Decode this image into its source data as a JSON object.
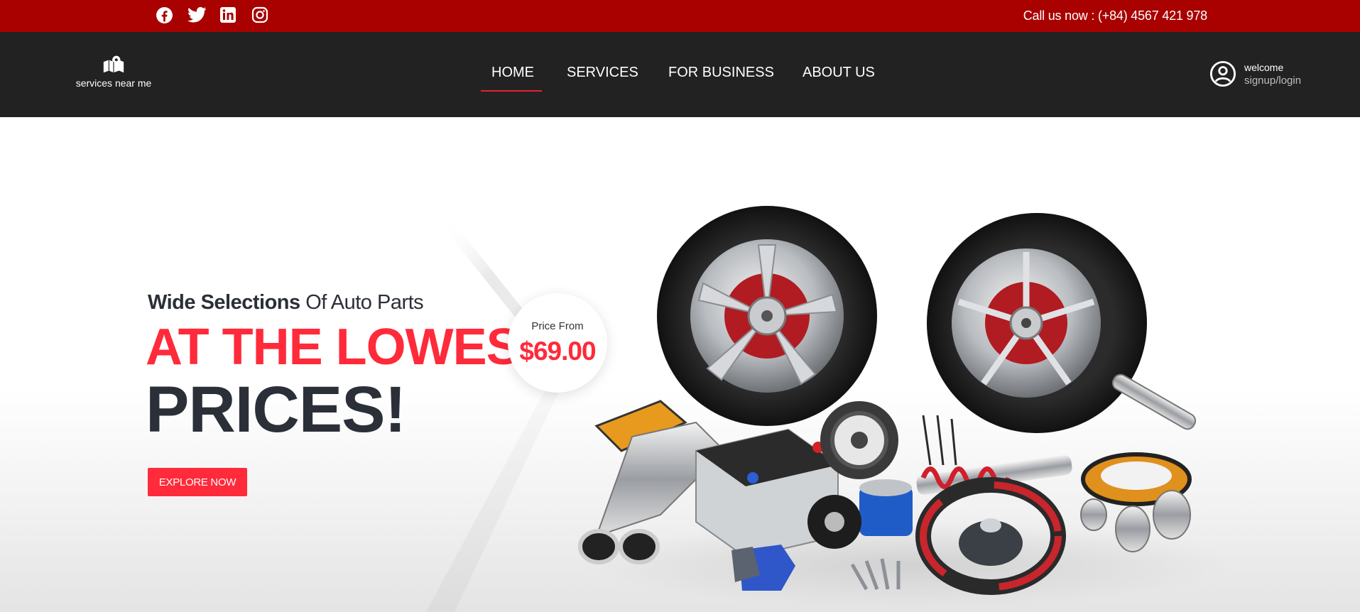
{
  "topbar": {
    "social": [
      {
        "name": "facebook-icon"
      },
      {
        "name": "twitter-icon"
      },
      {
        "name": "linkedin-icon"
      },
      {
        "name": "instagram-icon"
      }
    ],
    "call_text": "Call us now : (+84) 4567 421 978",
    "bg_color": "#a90000"
  },
  "nav": {
    "services_near_label": "services near me",
    "menu": [
      {
        "label": "HOME",
        "active": true
      },
      {
        "label": "SERVICES"
      },
      {
        "label": "FOR BUSINESS"
      },
      {
        "label": "ABOUT US"
      }
    ],
    "account": {
      "welcome": "welcome",
      "signup": "signup/login"
    },
    "bg_color": "#222222",
    "active_color": "#e8202f"
  },
  "hero": {
    "subtitle_bold": "Wide Selections",
    "subtitle_rest": " Of Auto Parts",
    "headline_red": "AT THE LOWEST",
    "headline_dark": "PRICES!",
    "cta_label": "EXPLORE NOW",
    "price_label": "Price From",
    "price_value": "$69.00",
    "accent_color": "#ff2a3a"
  }
}
